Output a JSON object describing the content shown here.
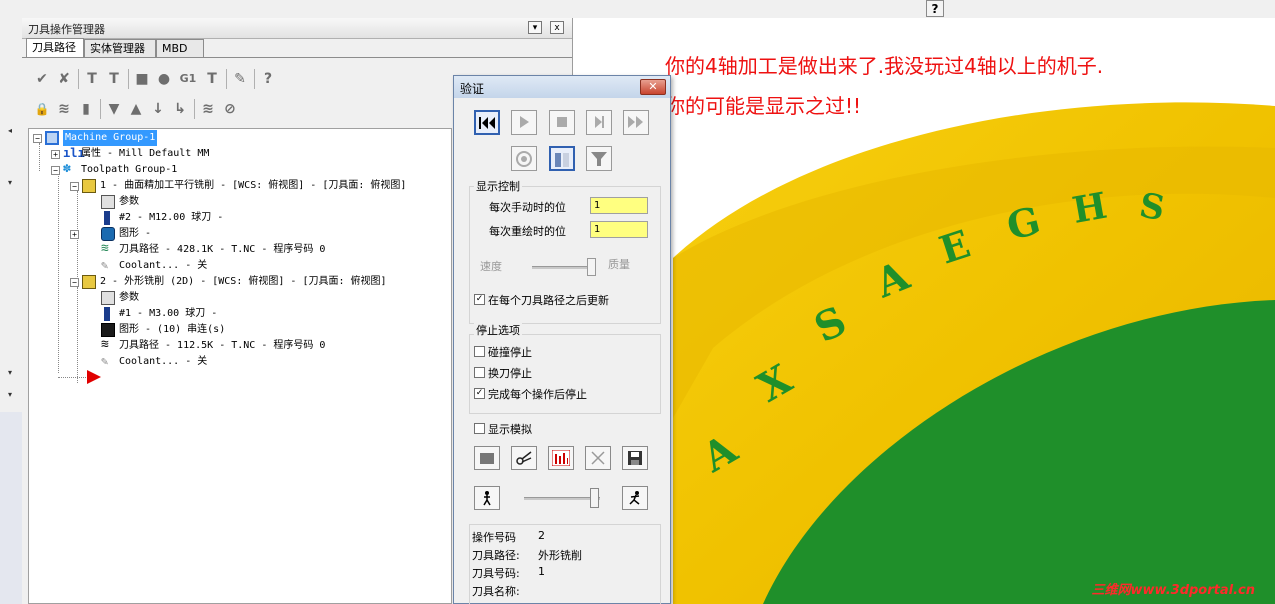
{
  "panel": {
    "title": "刀具操作管理器",
    "dropdown_glyph": "▾",
    "close_glyph": "x",
    "tabs": [
      {
        "label": "刀具路径"
      },
      {
        "label": "实体管理器"
      },
      {
        "label": "MBD"
      }
    ]
  },
  "toolbar": {
    "row1": [
      "✔",
      "✘",
      "T",
      "T",
      "■",
      "●",
      "G1",
      "T",
      "✎",
      "?"
    ],
    "row2": [
      "🔒",
      "≋",
      "▮",
      "▼",
      "▲",
      "↓",
      "↳",
      "≋",
      "⊘"
    ]
  },
  "tree": {
    "machine_group": "Machine Group-1",
    "properties": "属性 - Mill Default MM",
    "toolpath_group": "Toolpath Group-1",
    "op1": {
      "title": "1 - 曲面精加工平行铣削 - [WCS: 俯视图] - [刀具面: 俯视图]",
      "params": "参数",
      "tool": "#2 - M12.00 球刀 -",
      "geometry": "图形 -",
      "toolpath": "刀具路径 - 428.1K - T.NC - 程序号码 0",
      "coolant": "Coolant... - 关"
    },
    "op2": {
      "title": "2 - 外形铣削 (2D) - [WCS: 俯视图] - [刀具面: 俯视图]",
      "params": "参数",
      "tool": "#1 - M3.00 球刀 -",
      "geometry": "图形 - (10) 串连(s)",
      "toolpath": "刀具路径 - 112.5K - T.NC - 程序号码 0",
      "coolant": "Coolant... - 关"
    }
  },
  "verify": {
    "title": "验证",
    "close_glyph": "✕",
    "display_group": "显示控制",
    "manual_label": "每次手动时的位",
    "manual_value": "1",
    "redraw_label": "每次重绘时的位",
    "redraw_value": "1",
    "speed_label": "速度",
    "quality_label": "质量",
    "update_after_each": {
      "label": "在每个刀具路径之后更新",
      "checked": true
    },
    "stop_group": "停止选项",
    "stop_collision": {
      "label": "碰撞停止",
      "checked": false
    },
    "stop_toolchange": {
      "label": "换刀停止",
      "checked": false
    },
    "stop_each_op": {
      "label": "完成每个操作后停止",
      "checked": true
    },
    "show_simulation": {
      "label": "显示模拟",
      "checked": false
    },
    "info": {
      "op_number_label": "操作号码",
      "op_number_value": "2",
      "toolpath_label": "刀具路径:",
      "toolpath_value": "外形铣削",
      "tool_number_label": "刀具号码:",
      "tool_number_value": "1",
      "tool_name_label": "刀具名称:",
      "tool_name_value": ""
    }
  },
  "viewport": {
    "message_line1": "你的4轴加工是做出来了.我没玩过4轴以上的机子.",
    "message_line2": "你的可能是显示之过!!",
    "engraved_letters": [
      "A",
      "X",
      "S",
      "A",
      "E",
      "G",
      "H",
      "S"
    ],
    "watermark": "三维网www.3dportal.cn",
    "colors": {
      "cylinder": "#f2c400",
      "face": "#1f8f2a",
      "text": "#1f8f2a",
      "message": "#ee1111"
    }
  },
  "help_glyph": "?"
}
